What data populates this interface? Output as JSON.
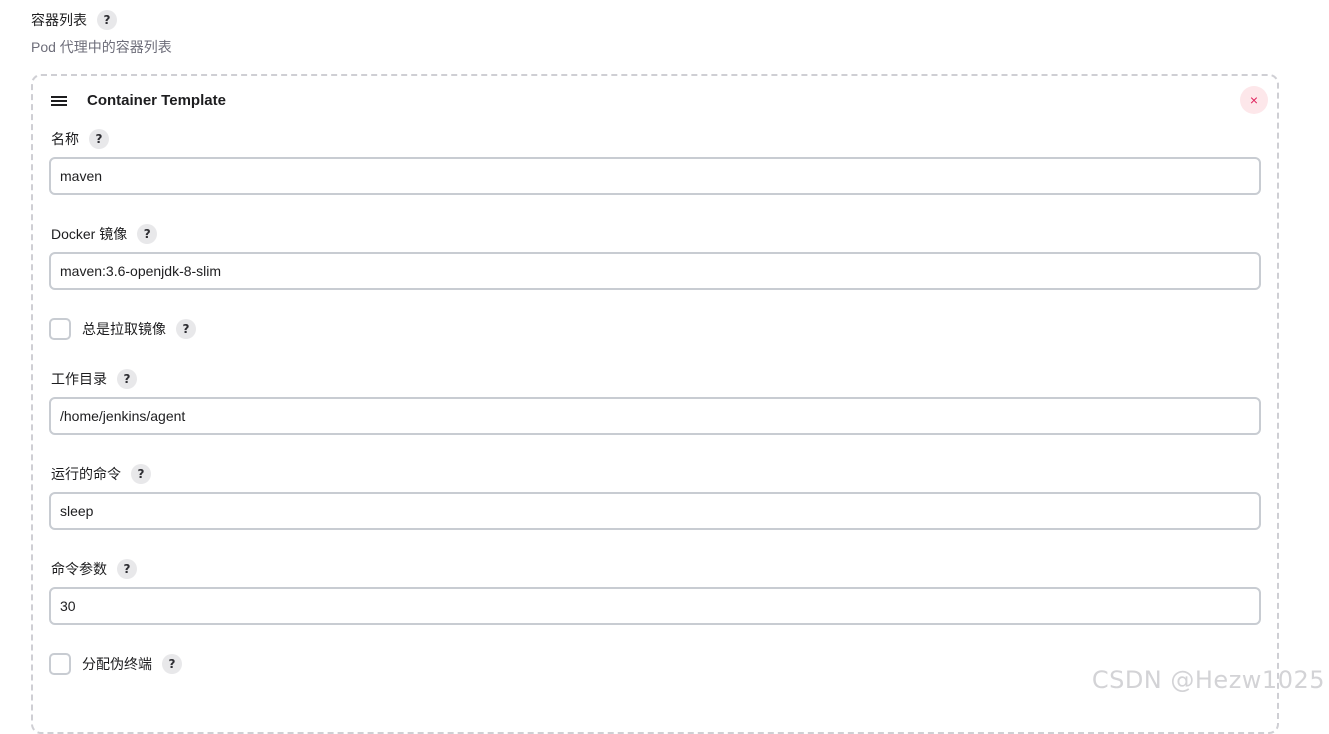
{
  "section": {
    "title": "容器列表",
    "description": "Pod 代理中的容器列表"
  },
  "help_label": "?",
  "card": {
    "title": "Container Template",
    "close_glyph": "×"
  },
  "fields": {
    "name": {
      "label": "名称",
      "value": "maven"
    },
    "docker_image": {
      "label": "Docker 镜像",
      "value": "maven:3.6-openjdk-8-slim"
    },
    "always_pull": {
      "label": "总是拉取镜像",
      "checked": false
    },
    "working_dir": {
      "label": "工作目录",
      "value": "/home/jenkins/agent"
    },
    "command": {
      "label": "运行的命令",
      "value": "sleep"
    },
    "args": {
      "label": "命令参数",
      "value": "30"
    },
    "tty": {
      "label": "分配伪终端",
      "checked": false
    }
  },
  "watermark": "CSDN @Hezw1025",
  "colors": {
    "close_bg": "#fde7ea",
    "close_fg": "#e0245e",
    "input_border": "#c8ccd2"
  },
  "icons": {
    "drag": "drag-handle-icon",
    "close": "close-icon",
    "help": "help-icon"
  }
}
